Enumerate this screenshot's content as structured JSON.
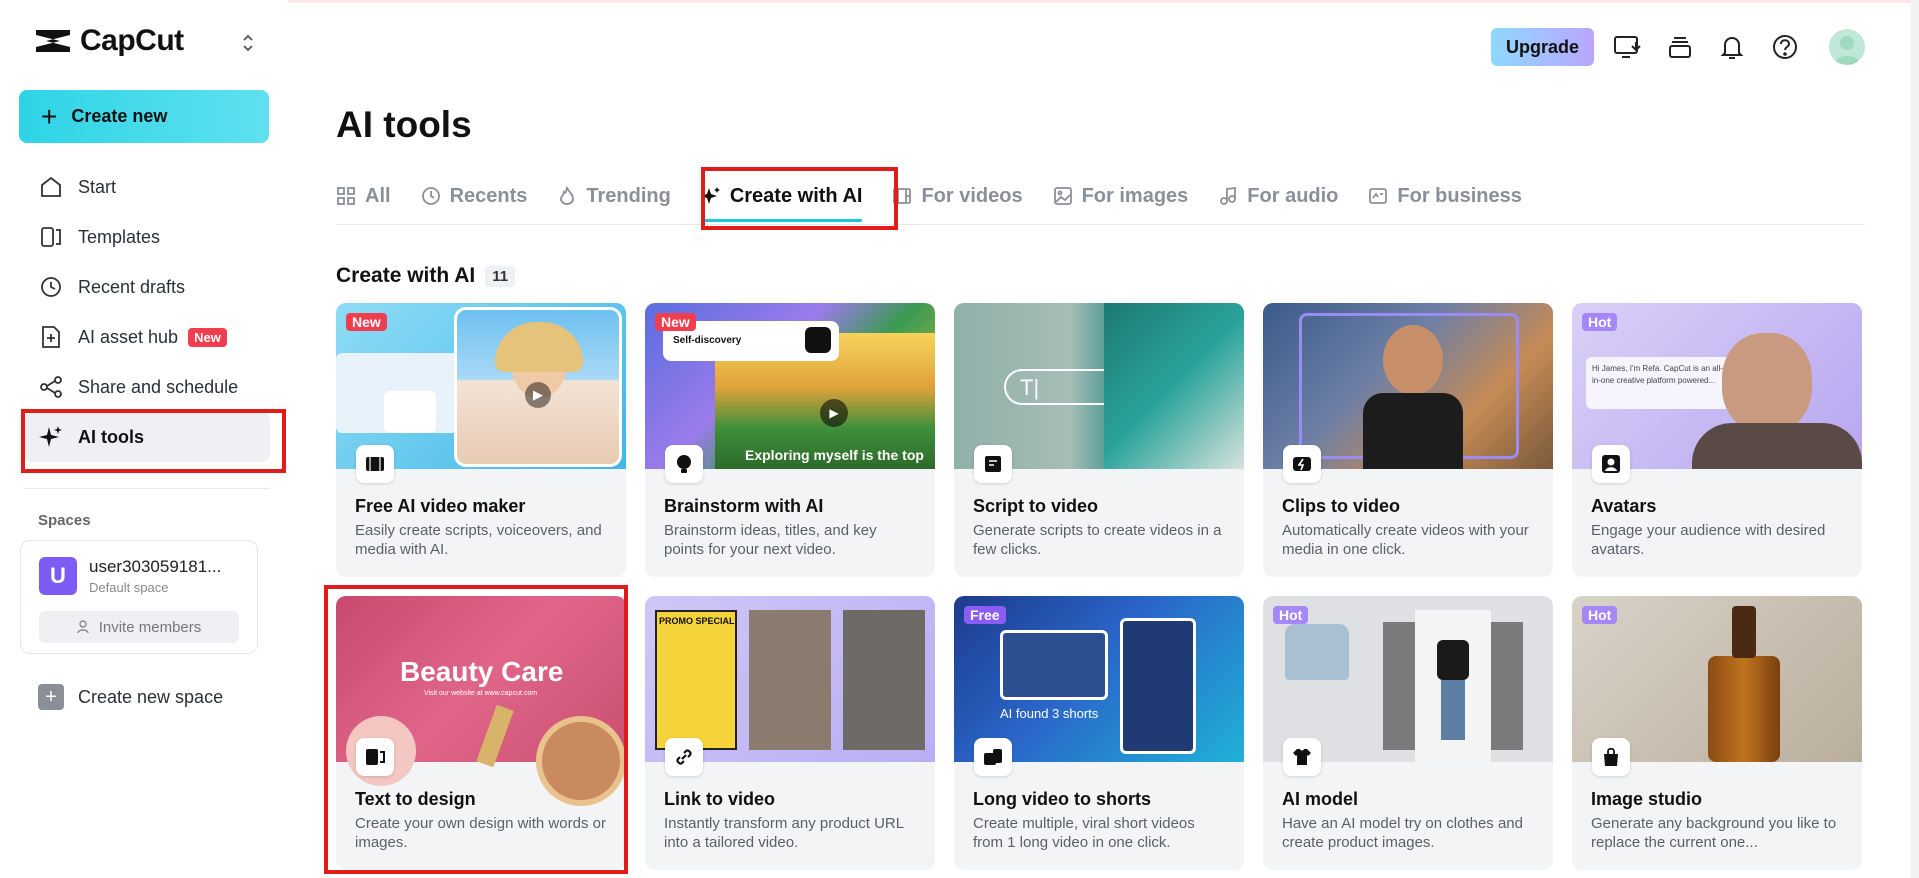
{
  "app": {
    "name": "CapCut"
  },
  "sidebar": {
    "create_label": "Create new",
    "items": [
      {
        "label": "Start",
        "icon": "home-icon"
      },
      {
        "label": "Templates",
        "icon": "templates-icon"
      },
      {
        "label": "Recent drafts",
        "icon": "clock-icon"
      },
      {
        "label": "AI asset hub",
        "icon": "asset-hub-icon",
        "badge": "New"
      },
      {
        "label": "Share and schedule",
        "icon": "share-icon"
      },
      {
        "label": "AI tools",
        "icon": "sparkle-icon",
        "active": true
      }
    ],
    "spaces_label": "Spaces",
    "space": {
      "initial": "U",
      "name": "user303059181...",
      "sub": "Default space",
      "invite_label": "Invite members"
    },
    "new_space_label": "Create new space"
  },
  "header": {
    "upgrade_label": "Upgrade"
  },
  "main": {
    "title": "AI tools",
    "tabs": [
      {
        "label": "All",
        "icon": "grid-icon"
      },
      {
        "label": "Recents",
        "icon": "clock-icon"
      },
      {
        "label": "Trending",
        "icon": "flame-icon"
      },
      {
        "label": "Create with AI",
        "icon": "sparkle-icon",
        "active": true
      },
      {
        "label": "For videos",
        "icon": "film-icon"
      },
      {
        "label": "For images",
        "icon": "image-icon"
      },
      {
        "label": "For audio",
        "icon": "music-icon"
      },
      {
        "label": "For business",
        "icon": "business-icon"
      }
    ],
    "section": {
      "title": "Create with AI",
      "count": "11"
    },
    "cards": [
      {
        "title": "Free AI video maker",
        "desc": "Easily create scripts, voiceovers, and media with AI.",
        "badge": "New",
        "thumb_text": ""
      },
      {
        "title": "Brainstorm with AI",
        "desc": "Brainstorm ideas, titles, and key points for your next video.",
        "badge": "New",
        "thumb_text": "Exploring myself is the top",
        "thumb_text2": "Self-discovery"
      },
      {
        "title": "Script to video",
        "desc": "Generate scripts to create videos in a few clicks.",
        "badge": "",
        "thumb_text": "T|"
      },
      {
        "title": "Clips to video",
        "desc": "Automatically create videos with your media in one click.",
        "badge": "",
        "thumb_text": ""
      },
      {
        "title": "Avatars",
        "desc": "Engage your audience with desired avatars.",
        "badge": "Hot",
        "thumb_text": "Hi James, I'm Refa. CapCut is an all-in-one creative platform powered..."
      },
      {
        "title": "Text to design",
        "desc": "Create your own design with words or images.",
        "badge": "",
        "thumb_text": "Beauty Care",
        "thumb_text2": "Visit our website at www.capcut.com"
      },
      {
        "title": "Link to video",
        "desc": "Instantly transform any product URL into a tailored video.",
        "badge": "",
        "thumb_text": "PROMO SPECIAL"
      },
      {
        "title": "Long video to shorts",
        "desc": "Create multiple, viral short videos from 1 long video in one click.",
        "badge": "Free",
        "thumb_text": "AI found 3 shorts"
      },
      {
        "title": "AI model",
        "desc": "Have an AI model try on clothes and create product images.",
        "badge": "Hot",
        "thumb_text": ""
      },
      {
        "title": "Image studio",
        "desc": "Generate any background you like to replace the current one...",
        "badge": "Hot",
        "thumb_text": ""
      }
    ]
  }
}
